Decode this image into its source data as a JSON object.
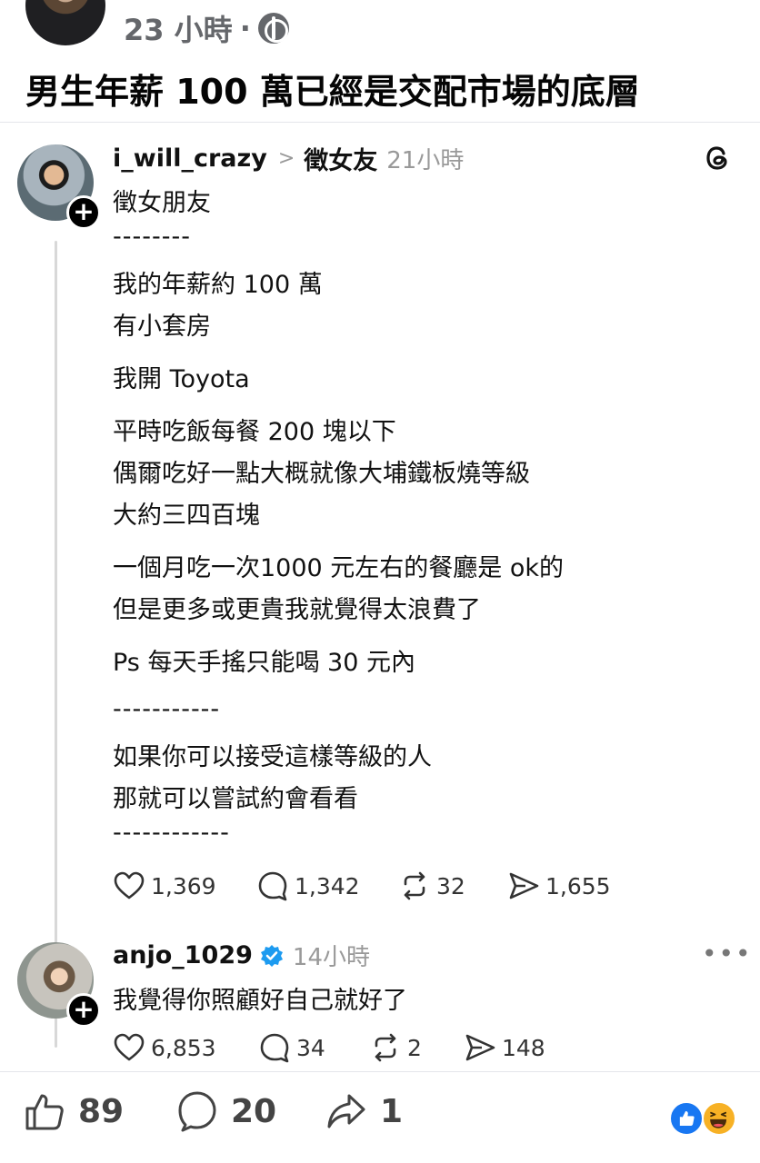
{
  "header": {
    "time": "23 小時",
    "separator": "·",
    "title": "男生年薪 100 萬已經是交配市場的底層"
  },
  "post1": {
    "username": "i_will_crazy",
    "community": "徵女友",
    "time": "21小時",
    "lines": [
      "徵女朋友",
      "--------",
      "我的年薪約 100 萬",
      "有小套房",
      "我開 Toyota",
      "平時吃飯每餐 200 塊以下",
      "偶爾吃好一點大概就像大埔鐵板燒等級",
      "大約三四百塊",
      "一個月吃一次1000 元左右的餐廳是 ok的",
      "但是更多或更貴我就覺得太浪費了",
      "Ps 每天手搖只能喝 30 元內",
      "-----------",
      "如果你可以接受這樣等級的人",
      "那就可以嘗試約會看看",
      "------------"
    ],
    "likes": "1,369",
    "replies": "1,342",
    "reposts": "32",
    "shares": "1,655"
  },
  "post2": {
    "username": "anjo_1029",
    "time": "14小時",
    "text": "我覺得你照顧好自己就好了",
    "likes": "6,853",
    "replies": "34",
    "reposts": "2",
    "shares": "148"
  },
  "fb_actions": {
    "likes": "89",
    "comments": "20",
    "shares": "1"
  },
  "icons": {
    "verified_color": "#1d9bf0",
    "like_reaction_color": "#1877f2",
    "haha_reaction_color": "#f7b125"
  }
}
